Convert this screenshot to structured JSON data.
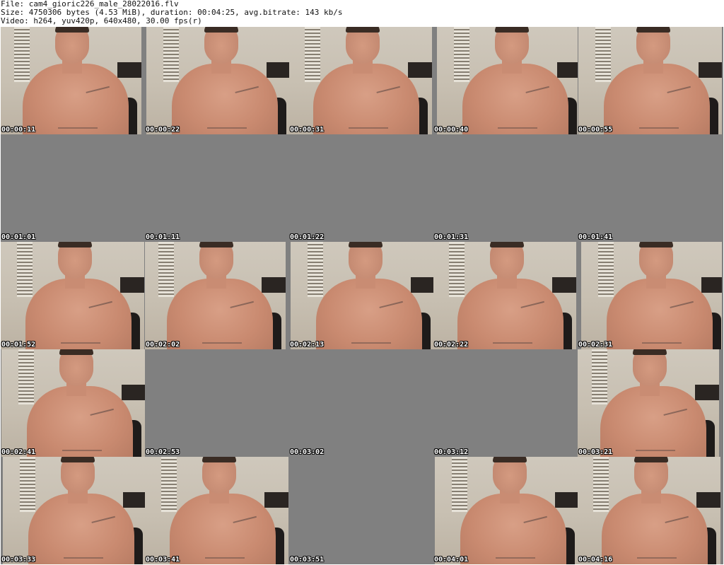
{
  "header": {
    "file_line": "File: cam4_gioric226_male_28022016.flv",
    "size_line": "Size: 4750306 bytes (4.53 MiB), duration: 00:04:25, avg.bitrate: 143 kb/s",
    "video_line": "Video: h264, yuv420p, 640x480, 30.00 fps(r)"
  },
  "thumbnails": [
    {
      "time": "00:00:11",
      "blank": false
    },
    {
      "time": "00:00:22",
      "blank": false
    },
    {
      "time": "00:00:31",
      "blank": false
    },
    {
      "time": "00:00:40",
      "blank": false
    },
    {
      "time": "00:00:55",
      "blank": false
    },
    {
      "time": "00:01:01",
      "blank": true
    },
    {
      "time": "00:01:11",
      "blank": true
    },
    {
      "time": "00:01:22",
      "blank": true
    },
    {
      "time": "00:01:31",
      "blank": true
    },
    {
      "time": "00:01:41",
      "blank": true
    },
    {
      "time": "00:01:52",
      "blank": false
    },
    {
      "time": "00:02:02",
      "blank": false
    },
    {
      "time": "00:02:13",
      "blank": false
    },
    {
      "time": "00:02:22",
      "blank": false
    },
    {
      "time": "00:02:31",
      "blank": false
    },
    {
      "time": "00:02:41",
      "blank": false
    },
    {
      "time": "00:02:53",
      "blank": true
    },
    {
      "time": "00:03:02",
      "blank": true
    },
    {
      "time": "00:03:12",
      "blank": true
    },
    {
      "time": "00:03:21",
      "blank": false
    },
    {
      "time": "00:03:33",
      "blank": false
    },
    {
      "time": "00:03:41",
      "blank": false
    },
    {
      "time": "00:03:51",
      "blank": true
    },
    {
      "time": "00:04:01",
      "blank": false
    },
    {
      "time": "00:04:16",
      "blank": false
    }
  ],
  "colors": {
    "blank_frame": "#808080",
    "timestamp_text": "#ffffff"
  }
}
